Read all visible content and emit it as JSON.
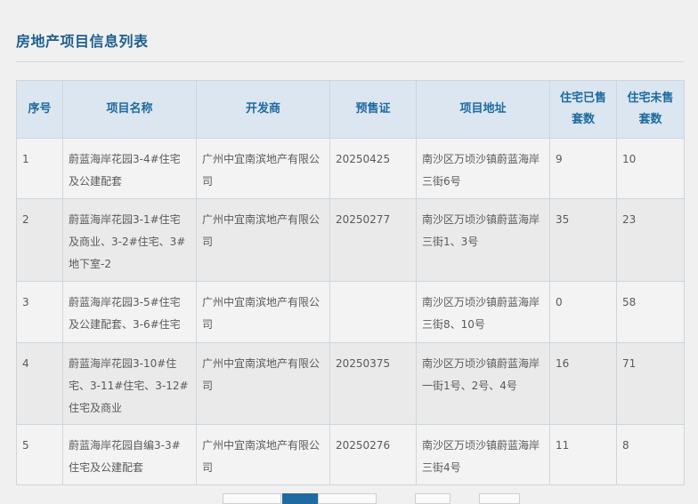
{
  "page_title": "房地产项目信息列表",
  "table": {
    "headers": [
      "序号",
      "项目名称",
      "开发商",
      "预售证",
      "项目地址",
      "住宅已售套数",
      "住宅未售套数"
    ],
    "rows": [
      [
        "1",
        "蔚蓝海岸花园3-4#住宅及公建配套",
        "广州中宜南滨地产有限公司",
        "20250425",
        "南沙区万顷沙镇蔚蓝海岸三街6号",
        "9",
        "10"
      ],
      [
        "2",
        "蔚蓝海岸花园3-1#住宅及商业、3-2#住宅、3#地下室-2",
        "广州中宜南滨地产有限公司",
        "20250277",
        "南沙区万顷沙镇蔚蓝海岸三街1、3号",
        "35",
        "23"
      ],
      [
        "3",
        "蔚蓝海岸花园3-5#住宅及公建配套、3-6#住宅",
        "广州中宜南滨地产有限公司",
        "",
        "南沙区万顷沙镇蔚蓝海岸三街8、10号",
        "0",
        "58"
      ],
      [
        "4",
        "蔚蓝海岸花园3-10#住宅、3-11#住宅、3-12#住宅及商业",
        "广州中宜南滨地产有限公司",
        "20250375",
        "南沙区万顷沙镇蔚蓝海岸一街1号、2号、4号",
        "16",
        "71"
      ],
      [
        "5",
        "蔚蓝海岸花园自编3-3#住宅及公建配套",
        "广州中宜南滨地产有限公司",
        "20250276",
        "南沙区万顷沙镇蔚蓝海岸三街4号",
        "11",
        "8"
      ]
    ]
  }
}
